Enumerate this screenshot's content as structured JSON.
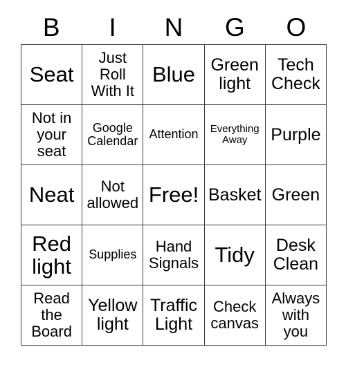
{
  "card": {
    "header_letters": [
      "B",
      "I",
      "N",
      "G",
      "O"
    ],
    "columns": 5,
    "rows": 5,
    "border_color": "#3a3a3a",
    "background_color": "#ffffff",
    "text_color": "#000000",
    "cells": [
      [
        {
          "text": "Seat",
          "size": "xl"
        },
        {
          "text": "Just\nRoll\nWith It",
          "size": "md"
        },
        {
          "text": "Blue",
          "size": "xl"
        },
        {
          "text": "Green\nlight",
          "size": "lg"
        },
        {
          "text": "Tech\nCheck",
          "size": "lg"
        }
      ],
      [
        {
          "text": "Not in\nyour\nseat",
          "size": "md"
        },
        {
          "text": "Google\nCalendar",
          "size": "sm"
        },
        {
          "text": "Attention",
          "size": "sm"
        },
        {
          "text": "Everything\nAway",
          "size": "xs"
        },
        {
          "text": "Purple",
          "size": "lg"
        }
      ],
      [
        {
          "text": "Neat",
          "size": "xl"
        },
        {
          "text": "Not\nallowed",
          "size": "md"
        },
        {
          "text": "Free!",
          "size": "xl"
        },
        {
          "text": "Basket",
          "size": "lg"
        },
        {
          "text": "Green",
          "size": "lg"
        }
      ],
      [
        {
          "text": "Red\nlight",
          "size": "xl"
        },
        {
          "text": "Supplies",
          "size": "sm"
        },
        {
          "text": "Hand\nSignals",
          "size": "md"
        },
        {
          "text": "Tidy",
          "size": "xl"
        },
        {
          "text": "Desk\nClean",
          "size": "lg"
        }
      ],
      [
        {
          "text": "Read\nthe\nBoard",
          "size": "md"
        },
        {
          "text": "Yellow\nlight",
          "size": "lg"
        },
        {
          "text": "Traffic\nLight",
          "size": "lg"
        },
        {
          "text": "Check\ncanvas",
          "size": "md"
        },
        {
          "text": "Always\nwith\nyou",
          "size": "md"
        }
      ]
    ]
  }
}
